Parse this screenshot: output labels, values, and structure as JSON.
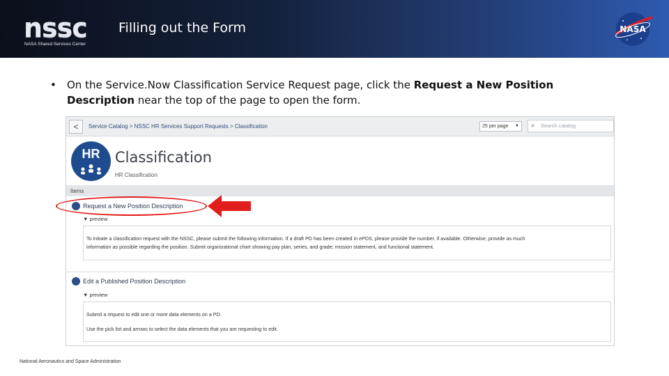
{
  "banner": {
    "logo_text": "nssc",
    "logo_subtitle": "NASA Shared Services Center",
    "title": "Filling out the Form",
    "nasa_logo_text": "NASA"
  },
  "instruction": {
    "bullet": "•",
    "text_before": "On the Service.Now Classification Service Request page, click the ",
    "bold": "Request a New Position Description",
    "text_after": " near the top of the page to open the form."
  },
  "screenshot": {
    "back_glyph": "<",
    "breadcrumb": "Service Catalog > NSSC HR Services Support Requests > Classification",
    "per_page": "25 per page",
    "search_placeholder": "Search catalog",
    "category_icon_text": "HR",
    "category_title": "Classification",
    "category_subtitle": "HR Classification",
    "items_label": "Items",
    "items": [
      {
        "title": "Request a New Position Description",
        "preview": "preview",
        "description_lines": [
          "To initiate a classification request with the NSSC, please submit the following information. If a draft PD has been created in ePDS, please provide the number, if available. Otherwise, provide as much",
          "information as possible regarding the position.  Submit organizational chart showing pay plan, series, and grade; mission statement, and functional statement."
        ]
      },
      {
        "title": "Edit a Published Position Description",
        "preview": "preview",
        "description_lines": [
          "Submit a request to edit one or more data elements on a PD.",
          "Use the pick list and arrows to select the data elements that you are requesting to edit."
        ]
      }
    ]
  },
  "footer": "National Aeronautics and Space Administration",
  "colors": {
    "banner_dark": "#0b0f1a",
    "banner_blue": "#2d5bb0",
    "highlight_red": "#e11d1d",
    "item_icon": "#2b4f86"
  }
}
